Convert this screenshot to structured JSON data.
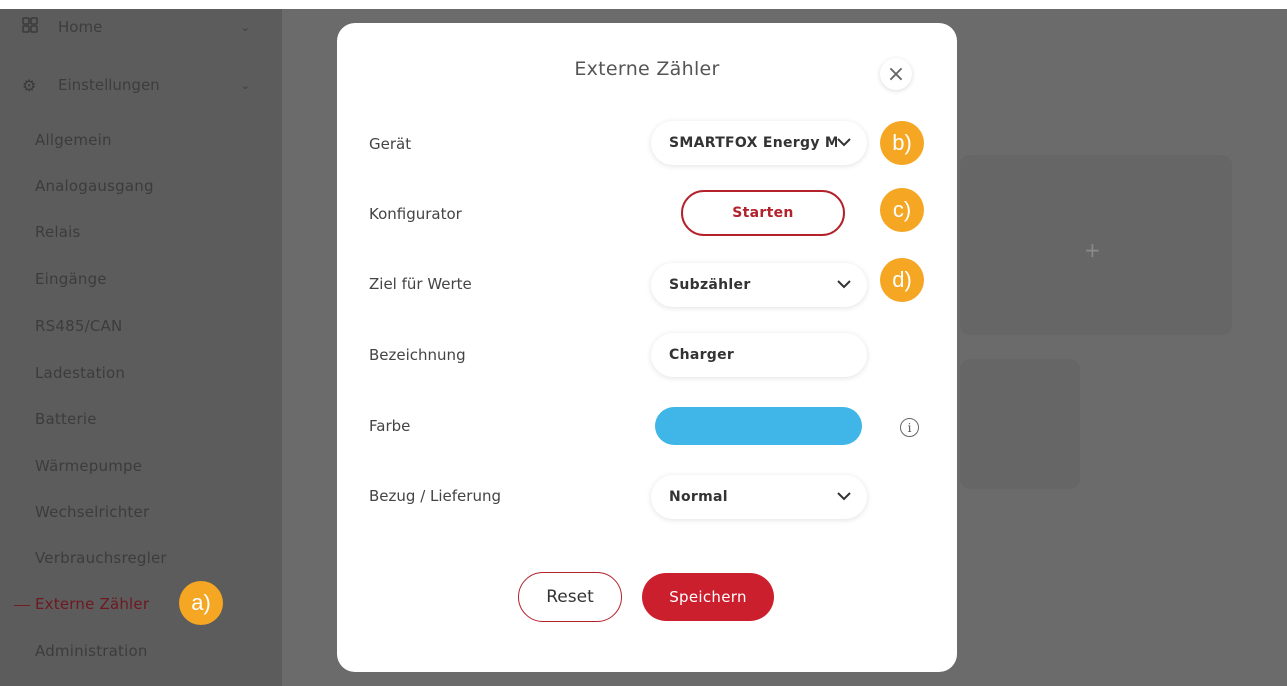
{
  "sidebar": {
    "home_label": "Home",
    "settings_label": "Einstellungen",
    "items": [
      {
        "label": "Allgemein"
      },
      {
        "label": "Analogausgang"
      },
      {
        "label": "Relais"
      },
      {
        "label": "Eingänge"
      },
      {
        "label": "RS485/CAN"
      },
      {
        "label": "Ladestation"
      },
      {
        "label": "Batterie"
      },
      {
        "label": "Wärmepumpe"
      },
      {
        "label": "Wechselrichter"
      },
      {
        "label": "Verbrauchsregler"
      },
      {
        "label": "Externe Zähler"
      },
      {
        "label": "Administration"
      }
    ],
    "active_item": "Externe Zähler"
  },
  "background": {
    "plus_symbol": "+"
  },
  "modal": {
    "title": "Externe Zähler",
    "close_symbol": "×",
    "rows": {
      "geraet": {
        "label": "Gerät",
        "value": "SMARTFOX Energy Meter"
      },
      "konfigurator": {
        "label": "Konfigurator",
        "button_label": "Starten"
      },
      "ziel": {
        "label": "Ziel für Werte",
        "value": "Subzähler"
      },
      "bezeichnung": {
        "label": "Bezeichnung",
        "value": "Charger"
      },
      "farbe": {
        "label": "Farbe",
        "color": "#3fb6e7"
      },
      "bezug": {
        "label": "Bezug / Lieferung",
        "value": "Normal"
      }
    },
    "info_symbol": "i",
    "reset_label": "Reset",
    "save_label": "Speichern"
  },
  "annotations": {
    "a": "a)",
    "b": "b)",
    "c": "c)",
    "d": "d)"
  },
  "colors": {
    "accent": "#cc1f2d",
    "badge": "#f5a623",
    "overlay": "#6b6b6b"
  }
}
